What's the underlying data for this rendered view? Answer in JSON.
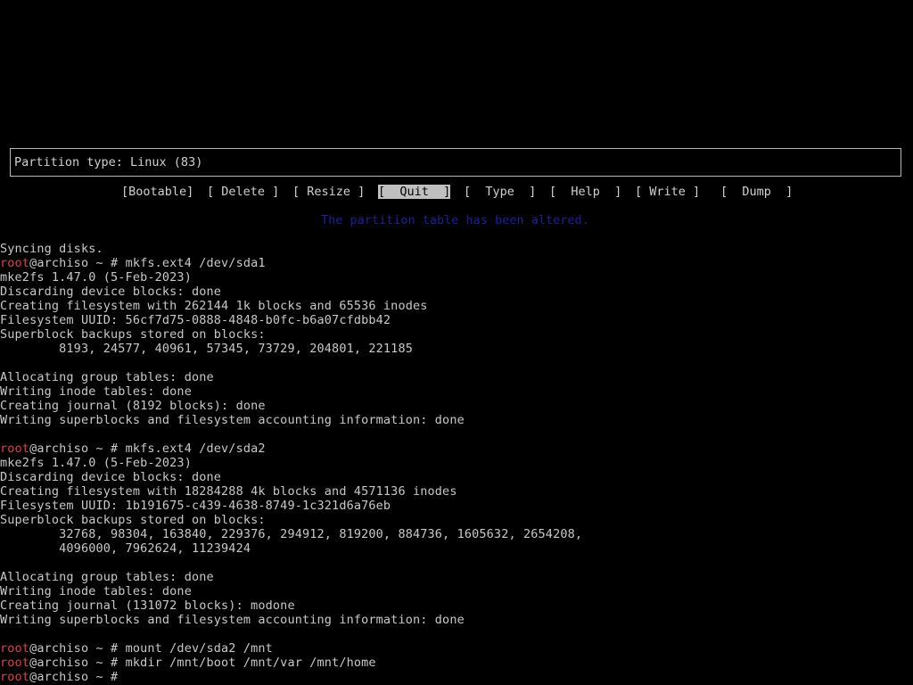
{
  "colors": {
    "background": "#000000",
    "text": "#c8c8c8",
    "prompt_user": "#e04040",
    "status_message": "#1f1f9e",
    "selected_menu_bg": "#bfbfbf"
  },
  "cfdisk": {
    "partition_type_label": "Partition type: Linux (83)",
    "menu": [
      {
        "label": "[Bootable]",
        "selected": false
      },
      {
        "label": "[ Delete ]",
        "selected": false
      },
      {
        "label": "[ Resize ]",
        "selected": false
      },
      {
        "label": "[  Quit  ]",
        "selected": true
      },
      {
        "label": "[  Type  ]",
        "selected": false
      },
      {
        "label": "[  Help  ]",
        "selected": false
      },
      {
        "label": "[ Write ]",
        "selected": false
      },
      {
        "label": "[  Dump  ]",
        "selected": false
      }
    ],
    "status_message": "The partition table has been altered."
  },
  "prompt": {
    "user": "root",
    "host_suffix": "@archiso ~ # "
  },
  "terminal": {
    "l0": "Syncing disks.",
    "cmd1": "mkfs.ext4 /dev/sda1",
    "l2": "mke2fs 1.47.0 (5-Feb-2023)",
    "l3": "Discarding device blocks: done",
    "l4": "Creating filesystem with 262144 1k blocks and 65536 inodes",
    "l5": "Filesystem UUID: 56cf7d75-0888-4848-b0fc-b6a07cfdbb42",
    "l6": "Superblock backups stored on blocks:",
    "l7": "        8193, 24577, 40961, 57345, 73729, 204801, 221185",
    "l9": "Allocating group tables: done",
    "l10": "Writing inode tables: done",
    "l11": "Creating journal (8192 blocks): done",
    "l12": "Writing superblocks and filesystem accounting information: done",
    "cmd2": "mkfs.ext4 /dev/sda2",
    "l15": "mke2fs 1.47.0 (5-Feb-2023)",
    "l16": "Discarding device blocks: done",
    "l17": "Creating filesystem with 18284288 4k blocks and 4571136 inodes",
    "l18": "Filesystem UUID: 1b191675-c439-4638-8749-1c321d6a76eb",
    "l19": "Superblock backups stored on blocks:",
    "l20": "        32768, 98304, 163840, 229376, 294912, 819200, 884736, 1605632, 2654208,",
    "l21": "        4096000, 7962624, 11239424",
    "l23": "Allocating group tables: done",
    "l24": "Writing inode tables: done",
    "l25": "Creating journal (131072 blocks): modone",
    "l26": "Writing superblocks and filesystem accounting information: done",
    "cmd3": "mount /dev/sda2 /mnt",
    "cmd4": "mkdir /mnt/boot /mnt/var /mnt/home",
    "cmd5": ""
  }
}
